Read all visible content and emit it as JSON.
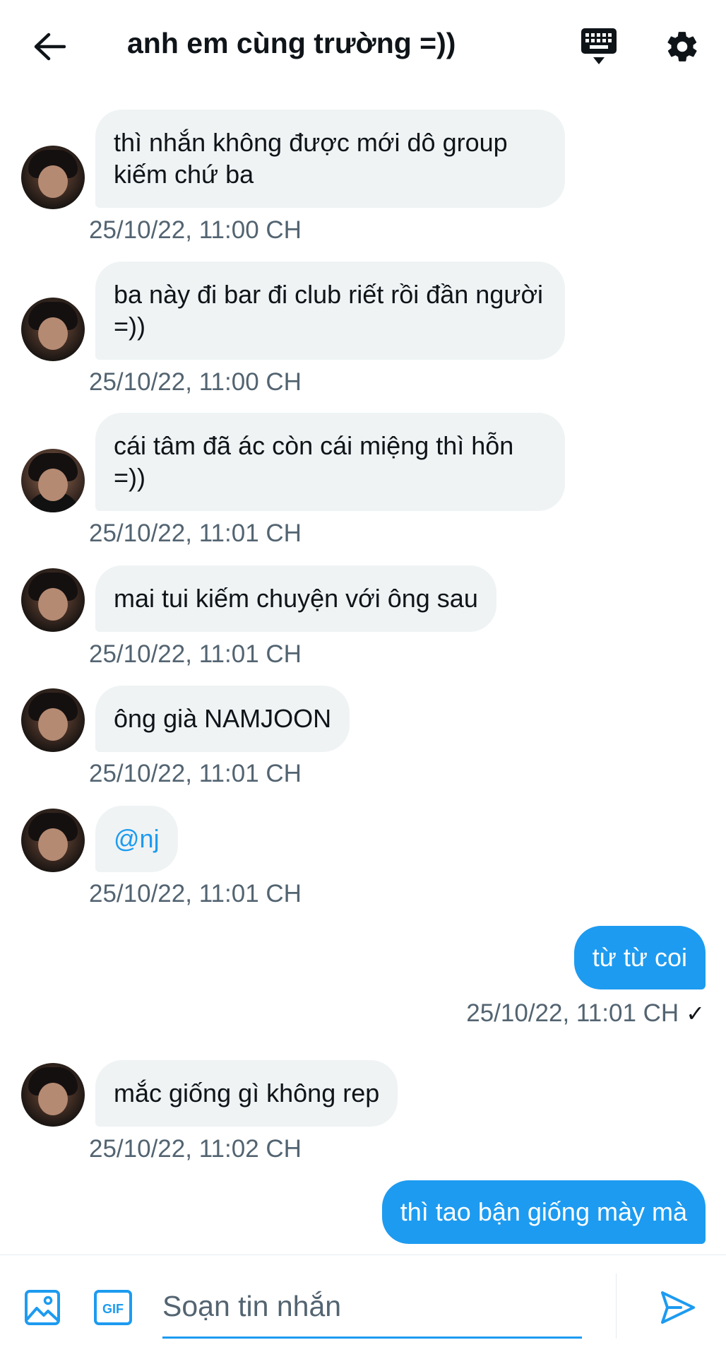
{
  "header": {
    "title": "anh em cùng trường =))",
    "back_icon": "arrow-left-icon",
    "keyboard_icon": "keyboard-icon",
    "settings_icon": "gear-icon"
  },
  "messages": [
    {
      "direction": "in",
      "text": "thì nhắn không được mới dô group kiếm chứ ba",
      "time": "25/10/22, 11:00 CH"
    },
    {
      "direction": "in",
      "text": "ba này đi bar đi club riết rồi đần người =))",
      "time": "25/10/22, 11:00 CH"
    },
    {
      "direction": "in",
      "text": "cái tâm đã ác còn cái miệng thì hỗn =))",
      "time": "25/10/22, 11:01 CH"
    },
    {
      "direction": "in",
      "text": "mai tui kiếm chuyện với ông sau",
      "time": "25/10/22, 11:01 CH"
    },
    {
      "direction": "in",
      "text": "ông già NAMJOON",
      "time": "25/10/22, 11:01 CH"
    },
    {
      "direction": "in",
      "text": "@nj",
      "time": "25/10/22, 11:01 CH"
    },
    {
      "direction": "out",
      "text": "từ từ coi",
      "time": "25/10/22, 11:01 CH"
    },
    {
      "direction": "in",
      "text": "mắc giống gì không rep",
      "time": "25/10/22, 11:02 CH"
    },
    {
      "direction": "out",
      "text": "thì tao bận giống mày mà",
      "time": ""
    }
  ],
  "composer": {
    "placeholder": "Soạn tin nhắn",
    "image_icon": "image-icon",
    "gif_label": "GIF",
    "send_icon": "send-icon"
  },
  "colors": {
    "accent": "#1d9bf0",
    "bubble_in": "#eff3f4",
    "muted_text": "#536471"
  }
}
